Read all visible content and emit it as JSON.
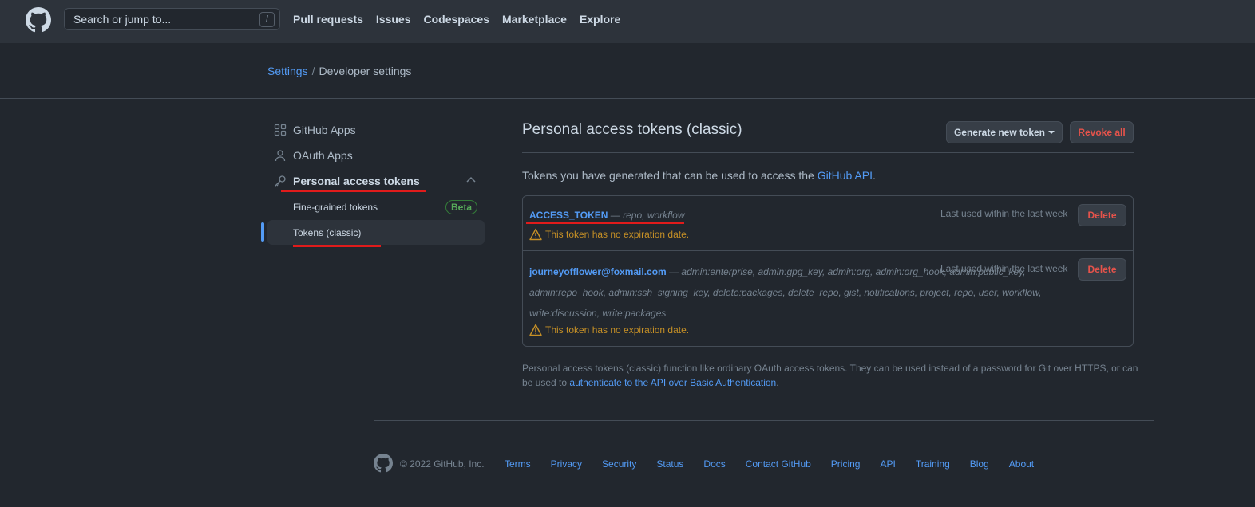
{
  "header": {
    "search_placeholder": "Search or jump to...",
    "search_shortcut": "/",
    "nav": [
      "Pull requests",
      "Issues",
      "Codespaces",
      "Marketplace",
      "Explore"
    ]
  },
  "breadcrumb": {
    "root": "Settings",
    "separator": "/",
    "current": "Developer settings"
  },
  "sidebar": {
    "github_apps": "GitHub Apps",
    "oauth_apps": "OAuth Apps",
    "personal_access_tokens": "Personal access tokens",
    "fine_grained": "Fine-grained tokens",
    "beta_badge": "Beta",
    "tokens_classic": "Tokens (classic)"
  },
  "main": {
    "title": "Personal access tokens (classic)",
    "generate_button": "Generate new token",
    "revoke_button": "Revoke all",
    "intro_prefix": "Tokens you have generated that can be used to access the ",
    "intro_link": "GitHub API",
    "intro_suffix": ".",
    "tokens": [
      {
        "name": "ACCESS_TOKEN",
        "scopes": " — repo, workflow",
        "last_used": "Last used within the last week",
        "warning": "This token has no expiration date.",
        "delete": "Delete"
      },
      {
        "name": "journeyofflower@foxmail.com",
        "scopes": " — admin:enterprise, admin:gpg_key, admin:org, admin:org_hook, admin:public_key, admin:repo_hook, admin:ssh_signing_key, delete:packages, delete_repo, gist, notifications, project, repo, user, workflow, write:discussion, write:packages",
        "last_used": "Last used within the last week",
        "warning": "This token has no expiration date.",
        "delete": "Delete"
      }
    ],
    "footnote_text": "Personal access tokens (classic) function like ordinary OAuth access tokens. They can be used instead of a password for Git over HTTPS, or can be used to ",
    "footnote_link": "authenticate to the API over Basic Authentication",
    "footnote_end": "."
  },
  "footer": {
    "copyright": "© 2022 GitHub, Inc.",
    "links": [
      "Terms",
      "Privacy",
      "Security",
      "Status",
      "Docs",
      "Contact GitHub",
      "Pricing",
      "API",
      "Training",
      "Blog",
      "About"
    ]
  },
  "colors": {
    "background": "#22272e",
    "header": "#2d333b",
    "link": "#539bf5",
    "danger": "#e5534b",
    "warning": "#c69026",
    "annotation": "#e01b1b"
  }
}
